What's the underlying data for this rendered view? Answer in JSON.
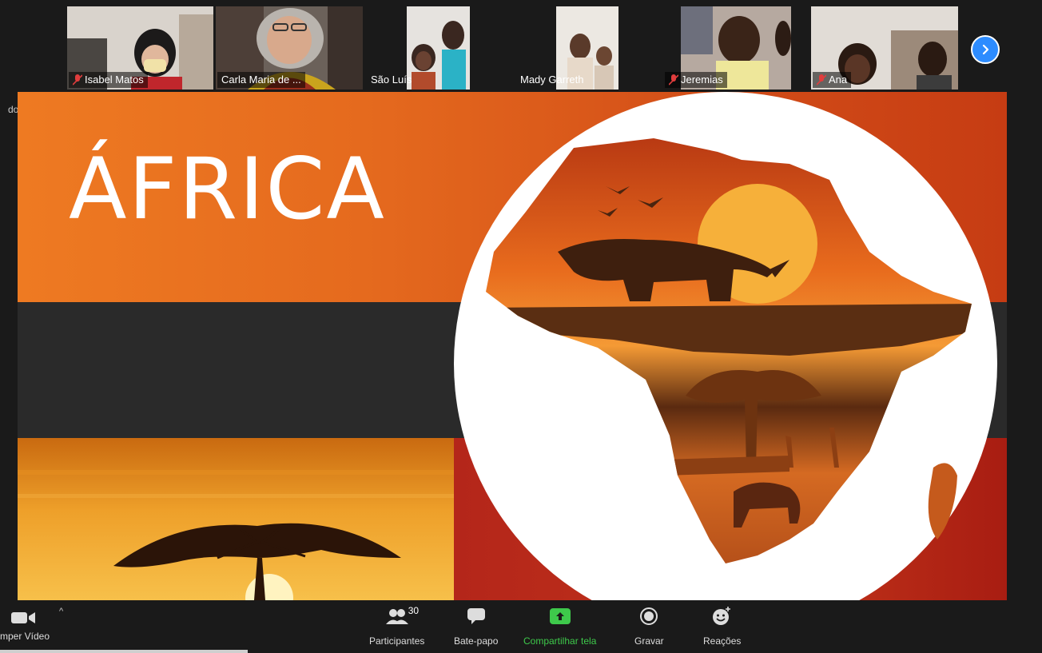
{
  "participants": [
    {
      "name": "Isabel Matos",
      "muted": true
    },
    {
      "name": "Carla Maria de ...",
      "muted": false,
      "active": true
    },
    {
      "name": "São Luís",
      "muted": false
    },
    {
      "name": "Mady Garreth",
      "muted": false
    },
    {
      "name": "Jeremias",
      "muted": true
    },
    {
      "name": "Ana",
      "muted": true
    }
  ],
  "side_label": "do",
  "slide": {
    "title": "ÁFRICA"
  },
  "toolbar": {
    "stop_video": "mper Vídeo",
    "participants_label": "Participantes",
    "participants_count": "30",
    "chat_label": "Bate-papo",
    "share_label": "Compartilhar tela",
    "record_label": "Gravar",
    "reactions_label": "Reações"
  },
  "colors": {
    "accent": "#2d8cff",
    "share_green": "#3ec94b",
    "active_speaker": "#7fc142"
  },
  "icons": [
    "mic-muted-icon",
    "chevron-right-icon",
    "camera-icon",
    "caret-up-icon",
    "participants-icon",
    "chat-icon",
    "share-screen-icon",
    "record-icon",
    "reactions-icon"
  ]
}
